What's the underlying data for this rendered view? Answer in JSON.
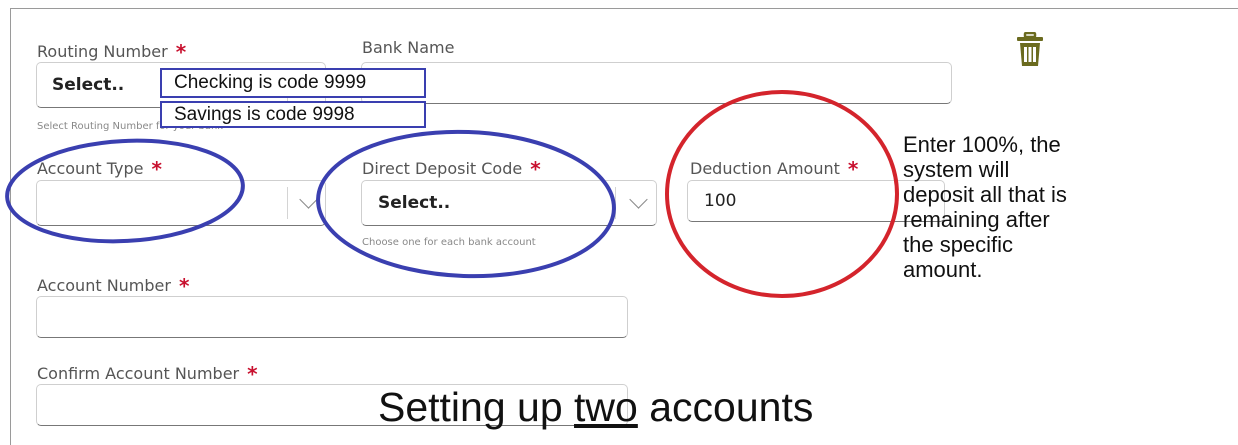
{
  "header": {
    "partial_title": "...Up..."
  },
  "routing": {
    "label": "Routing Number",
    "value": "Select..",
    "hint": "Select Routing Number for your bank"
  },
  "bank": {
    "label": "Bank Name",
    "value": ""
  },
  "account_type": {
    "label": "Account Type",
    "value": ""
  },
  "direct_deposit": {
    "label": "Direct Deposit Code",
    "value": "Select..",
    "hint": "Choose one for each bank account"
  },
  "deduction": {
    "label": "Deduction Amount",
    "value": "100"
  },
  "account_number": {
    "label": "Account Number",
    "value": ""
  },
  "confirm_account": {
    "label": "Confirm Account Number",
    "value": ""
  },
  "required_mark": "*",
  "annotations": {
    "checking": "Checking is code 9999",
    "savings": "Savings is code 9998",
    "note_lines": [
      "Enter 100%, the",
      "system will",
      "deposit all that is",
      "remaining after",
      "the specific",
      "amount."
    ],
    "footer_before": "Setting up ",
    "footer_underlined": "two",
    "footer_after": " accounts"
  },
  "colors": {
    "required": "#c8102e",
    "trash": "#6b6b1f",
    "blue_annotation": "#3a3fb0",
    "red_annotation": "#d4242c"
  },
  "icons": [
    "trash-icon",
    "chevron-down-icon"
  ]
}
